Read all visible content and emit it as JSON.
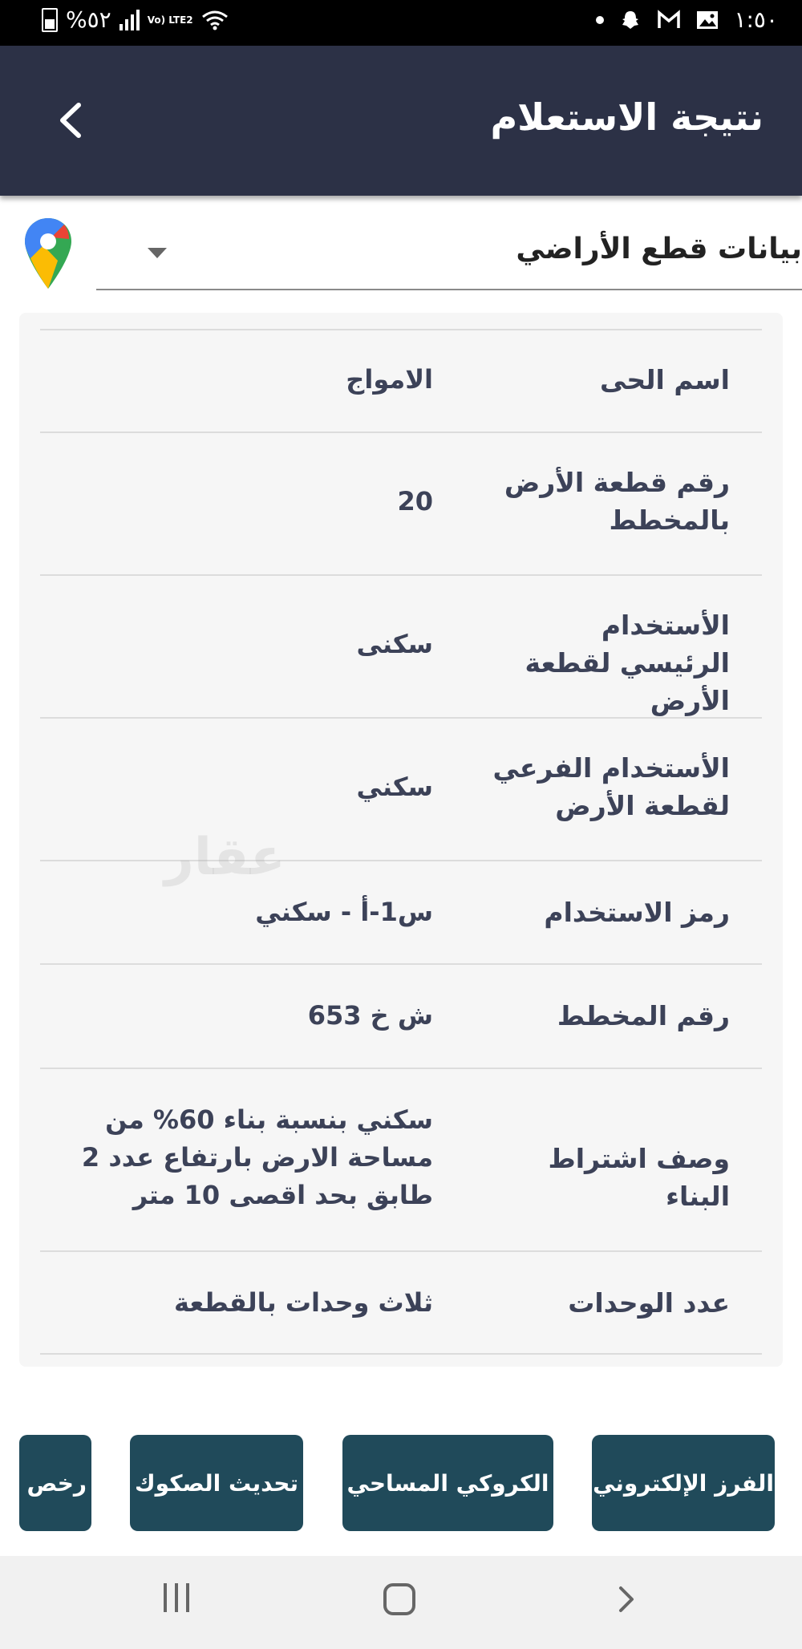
{
  "status_bar": {
    "battery_text": "%٥٢",
    "network_label": "Vo) LTE2",
    "time": "١:٥٠"
  },
  "header": {
    "title": "نتيجة الاستعلام"
  },
  "dropdown": {
    "selected": "بيانات قطع الأراضي"
  },
  "rows": [
    {
      "label": "اسم الحى",
      "value": "الامواج"
    },
    {
      "label": "رقم قطعة الأرض بالمخطط",
      "value": "20"
    },
    {
      "label": "الأستخدام الرئيسي لقطعة الأرض",
      "value": "سكنى"
    },
    {
      "label": "الأستخدام الفرعي لقطعة الأرض",
      "value": "سكني"
    },
    {
      "label": "رمز الاستخدام",
      "value": "س1-أ - سكني"
    },
    {
      "label": "رقم المخطط",
      "value": "ش خ 653"
    },
    {
      "label": "وصف اشتراط البناء",
      "value": "سكني بنسبة بناء 60% من مساحة الارض بارتفاع عدد 2 طابق بحد اقصى 10 متر"
    },
    {
      "label": "عدد الوحدات",
      "value": "ثلاث وحدات بالقطعة"
    }
  ],
  "watermark": {
    "text": "عقار"
  },
  "actions": [
    {
      "label": "الفرز الإلكتروني"
    },
    {
      "label": "الكروكي المساحي"
    },
    {
      "label": "تحديث الصكوك"
    },
    {
      "label": "رخص ا"
    }
  ]
}
